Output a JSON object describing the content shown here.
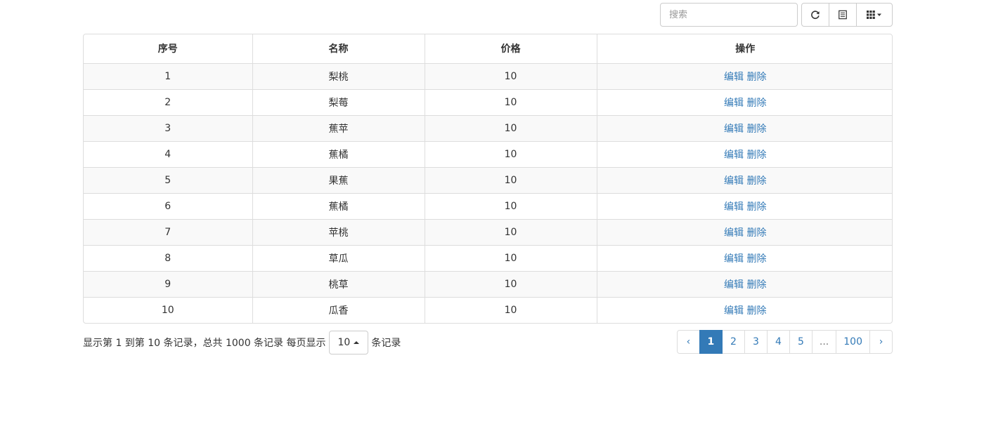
{
  "search": {
    "placeholder": "搜索",
    "value": ""
  },
  "toolbar": {
    "buttons": [
      {
        "name": "refresh",
        "icon": "refresh-icon"
      },
      {
        "name": "toggle-view",
        "icon": "list-alt-icon"
      },
      {
        "name": "columns",
        "icon": "columns-grid-icon"
      }
    ]
  },
  "table": {
    "columns": [
      "序号",
      "名称",
      "价格",
      "操作"
    ],
    "rows": [
      {
        "id": "1",
        "name": "梨桃",
        "price": "10"
      },
      {
        "id": "2",
        "name": "梨莓",
        "price": "10"
      },
      {
        "id": "3",
        "name": "蕉苹",
        "price": "10"
      },
      {
        "id": "4",
        "name": "蕉橘",
        "price": "10"
      },
      {
        "id": "5",
        "name": "果蕉",
        "price": "10"
      },
      {
        "id": "6",
        "name": "蕉橘",
        "price": "10"
      },
      {
        "id": "7",
        "name": "苹桃",
        "price": "10"
      },
      {
        "id": "8",
        "name": "草瓜",
        "price": "10"
      },
      {
        "id": "9",
        "name": "桃草",
        "price": "10"
      },
      {
        "id": "10",
        "name": "瓜香",
        "price": "10"
      }
    ],
    "actions": {
      "edit": "编辑",
      "delete": "删除"
    }
  },
  "footer": {
    "summary": "显示第 1 到第 10 条记录，总共 1000 条记录 每页显示",
    "page_size": "10",
    "suffix": "条记录"
  },
  "pagination": {
    "prev": "‹",
    "next": "›",
    "pages": [
      "1",
      "2",
      "3",
      "4",
      "5",
      "...",
      "100"
    ],
    "active": "1"
  },
  "colors": {
    "link": "#337ab7",
    "active_page_bg": "#337ab7",
    "stripe": "#f9f9f9",
    "border": "#dddddd"
  }
}
